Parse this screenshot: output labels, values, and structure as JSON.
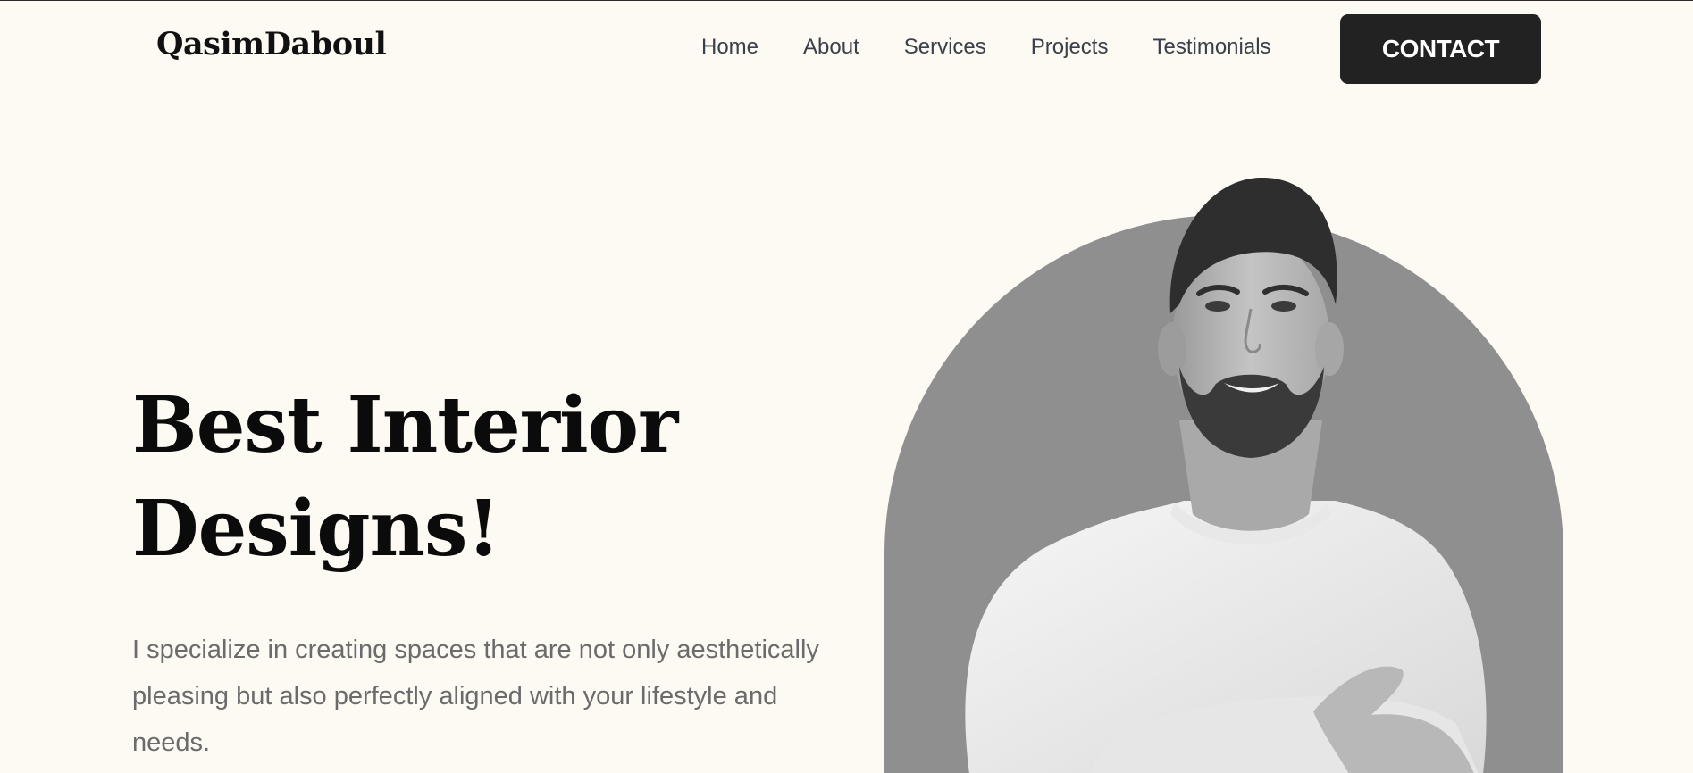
{
  "brand": {
    "logo": "QasimDaboul"
  },
  "nav": {
    "items": [
      {
        "label": "Home"
      },
      {
        "label": "About"
      },
      {
        "label": "Services"
      },
      {
        "label": "Projects"
      },
      {
        "label": "Testimonials"
      }
    ],
    "contact_label": "CONTACT"
  },
  "hero": {
    "title_line1": "Best Interior",
    "title_line2": "Designs!",
    "description": "I specialize in creating spaces that are not only aesthetically pleasing but also perfectly aligned with your lifestyle and needs."
  },
  "colors": {
    "background": "#fdf9f3",
    "button": "#222222",
    "arch": "#8f8f8f",
    "nav_text": "#3a4049",
    "body_text": "#6b6b6b"
  },
  "icons": {
    "portrait": "person-portrait-photo"
  }
}
